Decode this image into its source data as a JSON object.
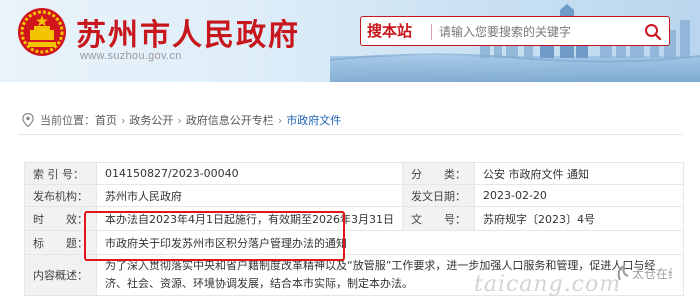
{
  "header": {
    "title": "苏州市人民政府",
    "url": "www.suzhou.gov.cn",
    "search_label": "搜本站",
    "search_placeholder": "请输入您要搜索的关键字"
  },
  "breadcrumb": {
    "prefix": "当前位置：",
    "items": [
      "首页",
      "政务公开",
      "政府信息公开专栏",
      "市政府文件"
    ]
  },
  "info": {
    "index_label": "索 引 号：",
    "index_value": "014150827/2023-00040",
    "category_label": "分　　类：",
    "category_value": "公安  市政府文件  通知",
    "issuer_label": "发布机构：",
    "issuer_value": "苏州市人民政府",
    "date_label": "发文日期：",
    "date_value": "2023-02-20",
    "validity_label": "时　　效：",
    "validity_value": "本办法自2023年4月1日起施行，有效期至2026年3月31日",
    "docno_label": "文　　号：",
    "docno_value": "苏府规字〔2023〕4号",
    "title_label": "标　　题：",
    "title_value": "市政府关于印发苏州市区积分落户管理办法的通知",
    "summary_label": "内容概述：",
    "summary_value": "为了深入贯彻落实中央和省户籍制度改革精神以及“放管服”工作要求，进一步加强人口服务和管理，促进人口与经济、社会、资源、环境协调发展，结合本市实际，制定本办法。"
  },
  "watermark": {
    "text": "taicang.com",
    "logo_text": "太仓在线"
  },
  "colors": {
    "brand_red": "#c8161d",
    "highlight": "#e3141b",
    "link_blue": "#1d63b8"
  }
}
